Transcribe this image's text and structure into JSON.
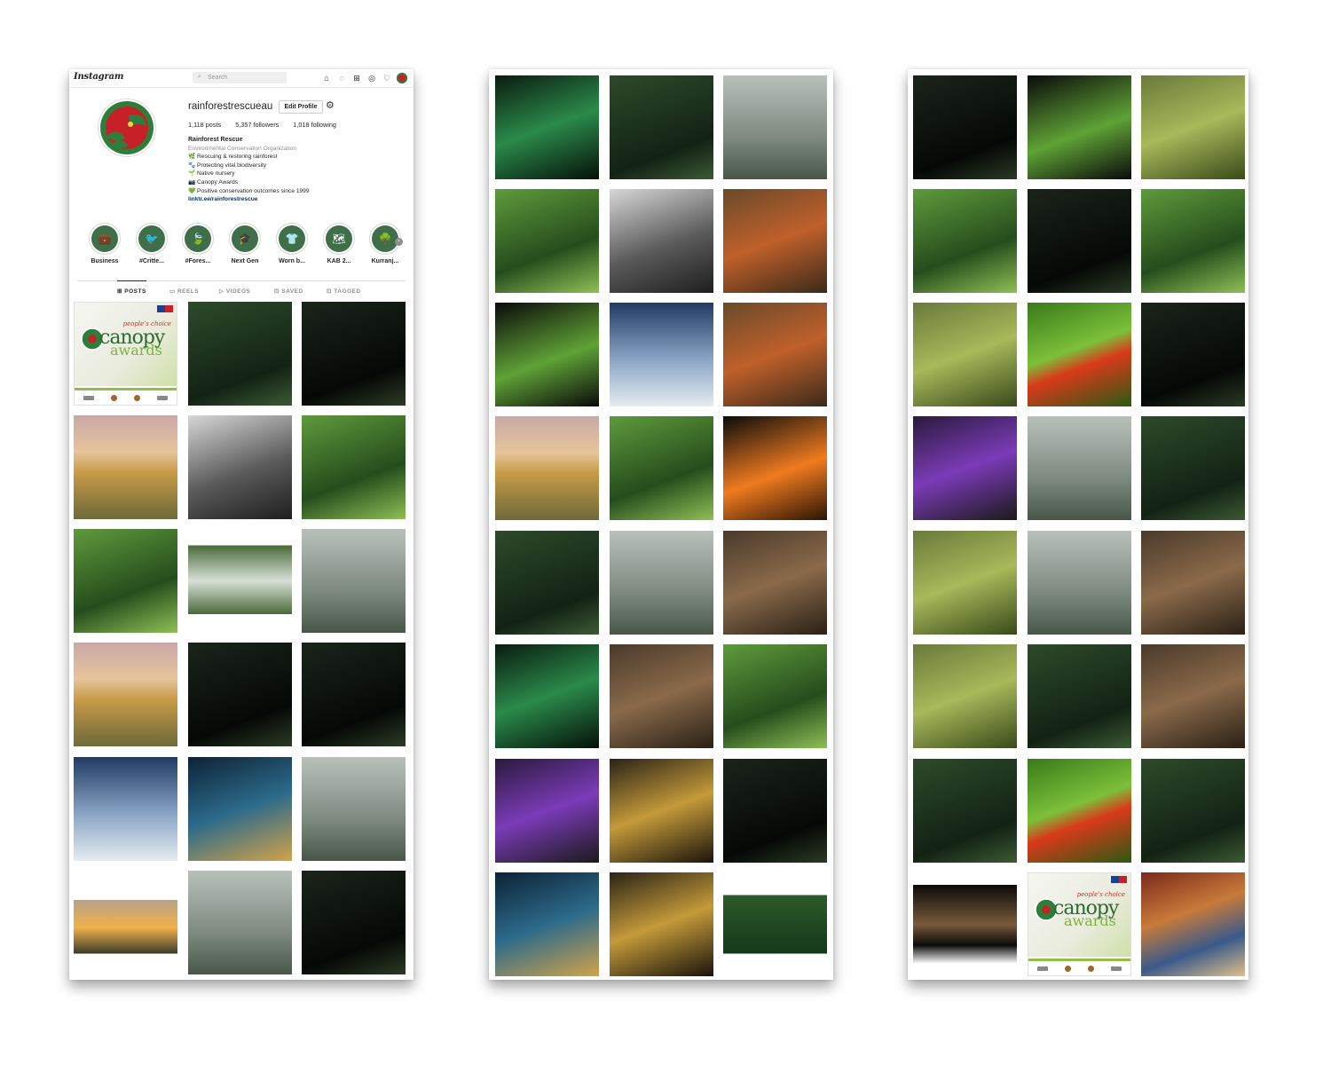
{
  "topbar": {
    "logo": "Instagram",
    "search_placeholder": "Search",
    "icons": [
      "home-icon",
      "messenger-icon",
      "new-post-icon",
      "explore-icon",
      "heart-icon",
      "profile-avatar"
    ]
  },
  "profile": {
    "username": "rainforestrescueau",
    "edit_label": "Edit Profile",
    "posts": "1,118 posts",
    "followers": "5,357 followers",
    "following": "1,018 following",
    "name": "Rainforest Rescue",
    "category": "Environmental Conservation Organization",
    "bio_lines": [
      "🌿 Rescuing & restoring rainforest",
      "🐾 Protecting vital biodiversity",
      "🌱 Native nursery",
      "📷 Canopy Awards",
      "💚 Positive conservation outcomes since 1999"
    ],
    "link": "linktr.ee/rainforestrescue"
  },
  "highlights": [
    {
      "label": "Business",
      "icon": "briefcase-icon"
    },
    {
      "label": "#Critte...",
      "icon": "emu-icon"
    },
    {
      "label": "#Fores...",
      "icon": "leaf-icon"
    },
    {
      "label": "Next Gen",
      "icon": "hat-icon"
    },
    {
      "label": "Worn b...",
      "icon": "tshirt-icon"
    },
    {
      "label": "KAB 2...",
      "icon": "australia-map-icon"
    },
    {
      "label": "Kurranj...",
      "icon": "tree-icon"
    }
  ],
  "tabs": [
    "POSTS",
    "REELS",
    "VIDEOS",
    "SAVED",
    "TAGGED"
  ],
  "canopy_tile": {
    "peoples_choice": "people's choice",
    "word1": "canopy",
    "word2": "awards"
  },
  "colors": {
    "brand_green": "#2f7d3a",
    "brand_red": "#c62128",
    "link_blue": "#00376b"
  },
  "grid_1": [
    {
      "name": "photo-forest-path"
    },
    {
      "name": "photo-waterfall-ferns"
    },
    {
      "name": "photo-beach-sunset"
    },
    {
      "name": "photo-misty-cliff-bw"
    },
    {
      "name": "photo-green-leaves"
    },
    {
      "name": "photo-river-reflection"
    },
    {
      "name": "photo-waterfall-sunbeams"
    },
    {
      "name": "photo-cascade"
    },
    {
      "name": "photo-mountain-fog"
    },
    {
      "name": "photo-dark-forest"
    },
    {
      "name": "photo-thin-waterfall"
    },
    {
      "name": "photo-cloud-forest"
    },
    {
      "name": "photo-canopy-from-below"
    },
    {
      "name": "photo-foggy-tree"
    },
    {
      "name": "photo-sunset-hills"
    },
    {
      "name": "photo-sunrays-trees"
    },
    {
      "name": "photo-dark-tree-trunks"
    }
  ],
  "grid_2": [
    {
      "name": "photo-glowing-fungi"
    },
    {
      "name": "photo-creek-waterfall"
    },
    {
      "name": "photo-misty-trunks"
    },
    {
      "name": "photo-aerial-road"
    },
    {
      "name": "photo-tree-stump-bw"
    },
    {
      "name": "photo-orangutan"
    },
    {
      "name": "photo-green-pod"
    },
    {
      "name": "photo-blue-forest-figure"
    },
    {
      "name": "photo-caged-orangutan"
    },
    {
      "name": "photo-dawn-valley"
    },
    {
      "name": "photo-girl-ferns"
    },
    {
      "name": "photo-orange-mushrooms"
    },
    {
      "name": "photo-mossy-log"
    },
    {
      "name": "photo-cassowary-road"
    },
    {
      "name": "photo-egret-roots"
    },
    {
      "name": "photo-glowing-fungi-2"
    },
    {
      "name": "photo-white-mushrooms"
    },
    {
      "name": "photo-tree-fern"
    },
    {
      "name": "photo-purple-mushrooms"
    },
    {
      "name": "photo-spiral-fern"
    },
    {
      "name": "photo-white-fungi-dark"
    },
    {
      "name": "photo-blue-fern-spiral"
    },
    {
      "name": "photo-yellow-mushroom"
    },
    {
      "name": "photo-forest-pond"
    }
  ],
  "grid_3": [
    {
      "name": "photo-black-waterfall"
    },
    {
      "name": "photo-lime-plant"
    },
    {
      "name": "photo-tiny-mushrooms"
    },
    {
      "name": "photo-baby-gorilla"
    },
    {
      "name": "photo-tapir"
    },
    {
      "name": "photo-gorillas-leaves"
    },
    {
      "name": "photo-kingfisher"
    },
    {
      "name": "photo-red-eyed-frogs"
    },
    {
      "name": "photo-gorilla-face"
    },
    {
      "name": "photo-water-lily"
    },
    {
      "name": "photo-chameleon"
    },
    {
      "name": "photo-hanging-roots"
    },
    {
      "name": "photo-hummingbird"
    },
    {
      "name": "photo-lizard"
    },
    {
      "name": "photo-cassowary-stream"
    },
    {
      "name": "photo-sunbird"
    },
    {
      "name": "photo-two-hummingbirds"
    },
    {
      "name": "photo-cassowary-head"
    },
    {
      "name": "photo-strangler-fig"
    },
    {
      "name": "photo-green-frog"
    },
    {
      "name": "photo-orangutan-water"
    },
    {
      "name": "photo-vine-orchid"
    },
    {
      "name": "photo-canopy-awards"
    },
    {
      "name": "photo-dot-art-woman"
    }
  ]
}
